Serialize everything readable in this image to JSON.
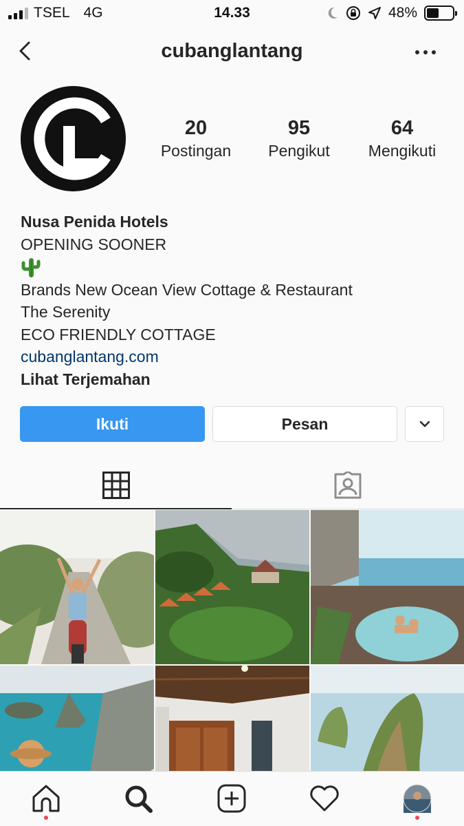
{
  "status_bar": {
    "carrier": "TSEL",
    "network": "4G",
    "time": "14.33",
    "battery": "48%",
    "battery_level": 0.48
  },
  "header": {
    "username": "cubanglantang"
  },
  "profile": {
    "stats": [
      {
        "count": "20",
        "label": "Postingan"
      },
      {
        "count": "95",
        "label": "Pengikut"
      },
      {
        "count": "64",
        "label": "Mengikuti"
      }
    ],
    "name": "Nusa Penida Hotels",
    "bio_lines": [
      "OPENING SOONER",
      "Brands New Ocean View Cottage & Restaurant",
      "The Serenity",
      "ECO FRIENDLY COTTAGE"
    ],
    "website": "cubanglantang.com",
    "translate_label": "Lihat Terjemahan"
  },
  "actions": {
    "follow_label": "Ikuti",
    "message_label": "Pesan"
  },
  "tabs": [
    {
      "icon": "grid-icon",
      "active": true
    },
    {
      "icon": "tagged-icon",
      "active": false
    }
  ],
  "posts": [
    {
      "subject": "woman on scooter on road"
    },
    {
      "subject": "aerial cottages by sea"
    },
    {
      "subject": "couple in rock pool"
    },
    {
      "subject": "sea rocks and beach"
    },
    {
      "subject": "wooden room interior"
    },
    {
      "subject": "cliff over sea"
    }
  ],
  "bottom_nav": [
    "home-icon",
    "search-icon",
    "new-post-icon",
    "activity-icon",
    "profile-avatar"
  ],
  "colors": {
    "primary": "#3897f0",
    "link": "#00376b",
    "notification": "#ed4956"
  }
}
